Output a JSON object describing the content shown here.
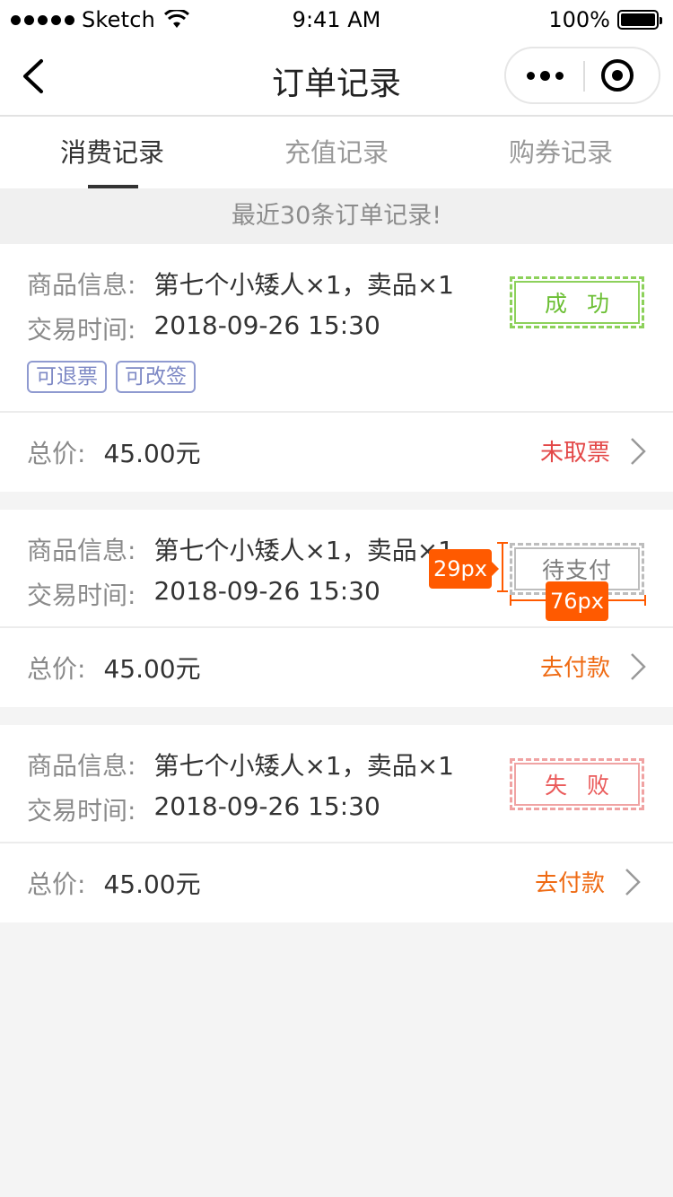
{
  "status_bar": {
    "carrier": "Sketch",
    "time": "9:41 AM",
    "battery": "100%"
  },
  "nav": {
    "title": "订单记录"
  },
  "tabs": [
    {
      "label": "消费记录",
      "active": true
    },
    {
      "label": "充值记录",
      "active": false
    },
    {
      "label": "购券记录",
      "active": false
    }
  ],
  "notice": "最近30条订单记录!",
  "orders": [
    {
      "product_label": "商品信息:",
      "product": "第七个小矮人×1，卖品×1",
      "time_label": "交易时间:",
      "time": "2018-09-26 15:30",
      "tags": [
        "可退票",
        "可改签"
      ],
      "status": "成功",
      "total_label": "总价:",
      "total": "45.00元",
      "action": "未取票"
    },
    {
      "product_label": "商品信息:",
      "product": "第七个小矮人×1，卖品×1",
      "time_label": "交易时间:",
      "time": "2018-09-26 15:30",
      "tags": [],
      "status": "待支付",
      "total_label": "总价:",
      "total": "45.00元",
      "action": "去付款"
    },
    {
      "product_label": "商品信息:",
      "product": "第七个小矮人×1，卖品×1",
      "time_label": "交易时间:",
      "time": "2018-09-26 15:30",
      "tags": [],
      "status": "失败",
      "total_label": "总价:",
      "total": "45.00元",
      "action": "去付款"
    }
  ],
  "annotations": {
    "height_label": "29px",
    "width_label": "76px"
  },
  "colors": {
    "success": "#6cbf34",
    "fail": "#ea5a5a",
    "pending": "#7d7d7d",
    "action_red": "#e34848",
    "action_orange": "#ef6b14",
    "tag": "#7e89c5",
    "annotation": "#ff5a00"
  }
}
